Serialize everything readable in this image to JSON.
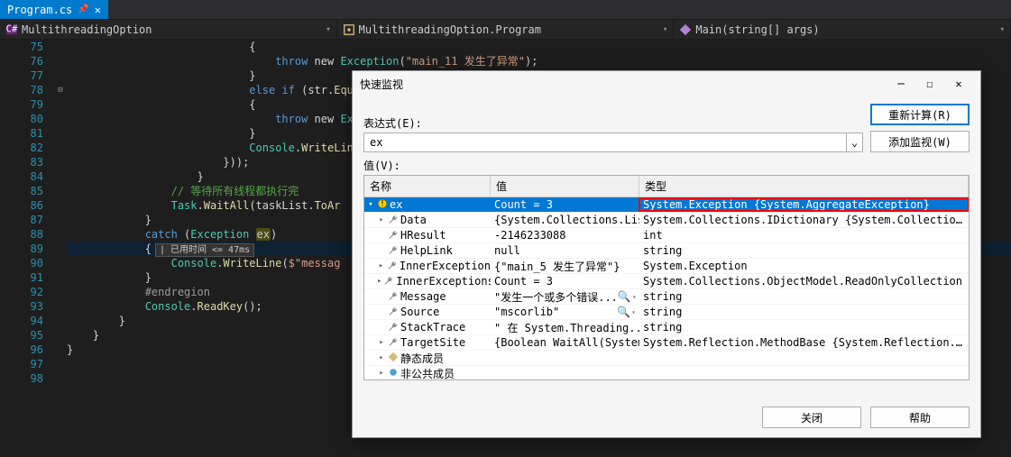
{
  "tab": {
    "filename": "Program.cs"
  },
  "nav": {
    "left": "MultithreadingOption",
    "middle": "MultithreadingOption.Program",
    "right": "Main(string[] args)"
  },
  "gutter": {
    "start": 75,
    "end": 98
  },
  "code": {
    "l75": "{",
    "l76a": "throw",
    "l76b": " new ",
    "l76c": "Exception",
    "l76d": "(",
    "l76e": "\"main_11 发生了异常\"",
    "l76f": ");",
    "l77": "}",
    "l78a": "else",
    "l78b": " if ",
    "l78c": "(str.",
    "l78d": "Equa",
    "l79": "{",
    "l80a": "throw",
    "l80b": " new ",
    "l80c": "Exce",
    "l81": "}",
    "l82a": "Console",
    "l82b": ".",
    "l82c": "WriteLine",
    "l83": "}));",
    "l84": "}",
    "l85": "// 等待所有线程都执行完",
    "l86a": "Task",
    "l86b": ".",
    "l86c": "WaitAll",
    "l86d": "(taskList.",
    "l86e": "ToAr",
    "l87": "}",
    "l88a": "catch",
    "l88b": " (",
    "l88c": "Exception",
    "l88d": " ",
    "l88e": "ex",
    "l88f": ")",
    "l89": "{",
    "l90": "| 已用时间 <= 47ms",
    "l91a": "Console",
    "l91b": ".",
    "l91c": "WriteLine",
    "l91d": "(",
    "l91e": "$\"messag",
    "l92": "}",
    "l93": "#endregion",
    "l94a": "Console",
    "l94b": ".",
    "l94c": "ReadKey",
    "l94d": "();",
    "l95": "}",
    "l96": "}",
    "l97": "}"
  },
  "dialog": {
    "title": "快速监视",
    "expr_label": "表达式(E):",
    "expr_value": "ex",
    "btn_recalc": "重新计算(R)",
    "btn_addwatch": "添加监视(W)",
    "val_label": "值(V):",
    "headers": {
      "name": "名称",
      "value": "值",
      "type": "类型"
    },
    "rows": [
      {
        "depth": 0,
        "exp": "down",
        "icon": "ex",
        "name": "ex",
        "value": "Count = 3",
        "type": "System.Exception {System.AggregateException}",
        "sel": true,
        "boxtype": true
      },
      {
        "depth": 1,
        "exp": "right",
        "icon": "wrench",
        "name": "Data",
        "value": "{System.Collections.ListDictio...",
        "type": "System.Collections.IDictionary {System.Collections.ListDictionar..."
      },
      {
        "depth": 1,
        "exp": "",
        "icon": "wrench",
        "name": "HResult",
        "value": "-2146233088",
        "type": "int"
      },
      {
        "depth": 1,
        "exp": "",
        "icon": "wrench",
        "name": "HelpLink",
        "value": "null",
        "type": "string"
      },
      {
        "depth": 1,
        "exp": "right",
        "icon": "wrench",
        "name": "InnerException",
        "value": "{\"main_5 发生了异常\"}",
        "type": "System.Exception"
      },
      {
        "depth": 1,
        "exp": "right",
        "icon": "wrench",
        "name": "InnerExceptions",
        "value": "Count = 3",
        "type": "System.Collections.ObjectModel.ReadOnlyCollection<System.E..."
      },
      {
        "depth": 1,
        "exp": "",
        "icon": "wrench",
        "name": "Message",
        "value": "\"发生一个或多个错误...",
        "mag": true,
        "type": "string"
      },
      {
        "depth": 1,
        "exp": "",
        "icon": "wrench",
        "name": "Source",
        "value": "\"mscorlib\"",
        "mag": true,
        "type": "string"
      },
      {
        "depth": 1,
        "exp": "",
        "icon": "wrench",
        "name": "StackTrace",
        "value": "\"   在 System.Threading....",
        "mag": true,
        "type": "string"
      },
      {
        "depth": 1,
        "exp": "right",
        "icon": "wrench",
        "name": "TargetSite",
        "value": "{Boolean WaitAll(System.Thre...",
        "type": "System.Reflection.MethodBase {System.Reflection.RuntimeMet..."
      },
      {
        "depth": 1,
        "exp": "right",
        "icon": "static",
        "name": "静态成员",
        "value": "",
        "type": ""
      },
      {
        "depth": 1,
        "exp": "right",
        "icon": "nonpub",
        "name": "非公共成员",
        "value": "",
        "type": ""
      }
    ],
    "btn_close": "关闭",
    "btn_help": "帮助"
  }
}
